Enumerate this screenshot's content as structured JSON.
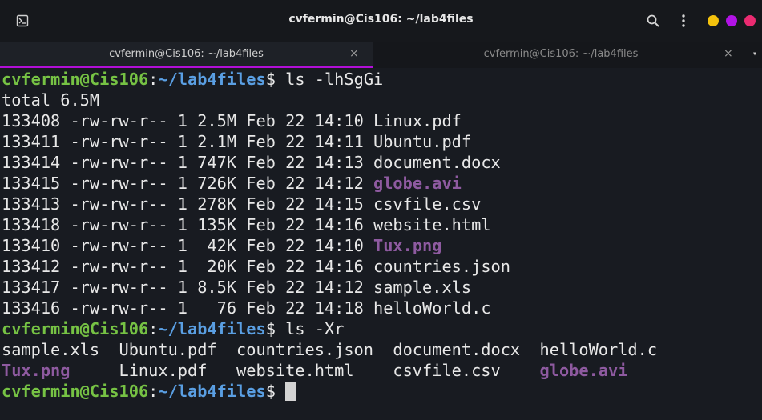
{
  "window": {
    "title": "cvfermin@Cis106: ~/lab4files",
    "icons": {
      "app": "terminal-icon",
      "search": "search-icon",
      "menu": "kebab-menu-icon"
    },
    "colors": {
      "minimize": "#f4c20d",
      "maximize": "#b213e6",
      "close": "#ea2b71"
    }
  },
  "tabs": [
    {
      "label": "cvfermin@Cis106: ~/lab4files",
      "close": "×",
      "active": true
    },
    {
      "label": "cvfermin@Cis106: ~/lab4files",
      "close": "×",
      "active": false
    }
  ],
  "tab_overflow": "▾",
  "prompt": {
    "user": "cvfermin@Cis106",
    "sep": ":",
    "path": "~/lab4files",
    "symbol": "$"
  },
  "colors": {
    "user": "#76c244",
    "path": "#5a9fe3",
    "media": "#8e5aa0",
    "text": "#e8e8e8"
  },
  "commands": [
    " ls -lhSgGi",
    " ls -Xr",
    " "
  ],
  "total_line": "total 6.5M",
  "listing": [
    {
      "meta": "133408 -rw-rw-r-- 1 2.5M Feb 22 14:10 ",
      "name": "Linux.pdf",
      "media": false
    },
    {
      "meta": "133411 -rw-rw-r-- 1 2.1M Feb 22 14:11 ",
      "name": "Ubuntu.pdf",
      "media": false
    },
    {
      "meta": "133414 -rw-rw-r-- 1 747K Feb 22 14:13 ",
      "name": "document.docx",
      "media": false
    },
    {
      "meta": "133415 -rw-rw-r-- 1 726K Feb 22 14:12 ",
      "name": "globe.avi",
      "media": true
    },
    {
      "meta": "133413 -rw-rw-r-- 1 278K Feb 22 14:15 ",
      "name": "csvfile.csv",
      "media": false
    },
    {
      "meta": "133418 -rw-rw-r-- 1 135K Feb 22 14:16 ",
      "name": "website.html",
      "media": false
    },
    {
      "meta": "133410 -rw-rw-r-- 1  42K Feb 22 14:10 ",
      "name": "Tux.png",
      "media": true
    },
    {
      "meta": "133412 -rw-rw-r-- 1  20K Feb 22 14:16 ",
      "name": "countries.json",
      "media": false
    },
    {
      "meta": "133417 -rw-rw-r-- 1 8.5K Feb 22 14:12 ",
      "name": "sample.xls",
      "media": false
    },
    {
      "meta": "133416 -rw-rw-r-- 1   76 Feb 22 14:18 ",
      "name": "helloWorld.c",
      "media": false
    }
  ],
  "ls_xr": [
    [
      {
        "name": "sample.xls",
        "media": false
      },
      {
        "name": "Ubuntu.pdf",
        "media": false
      },
      {
        "name": "countries.json",
        "media": false
      },
      {
        "name": "document.docx",
        "media": false
      },
      {
        "name": "helloWorld.c",
        "media": false
      }
    ],
    [
      {
        "name": "Tux.png",
        "media": true
      },
      {
        "name": "Linux.pdf",
        "media": false
      },
      {
        "name": "website.html",
        "media": false
      },
      {
        "name": "csvfile.csv",
        "media": false
      },
      {
        "name": "globe.avi",
        "media": true
      }
    ]
  ]
}
